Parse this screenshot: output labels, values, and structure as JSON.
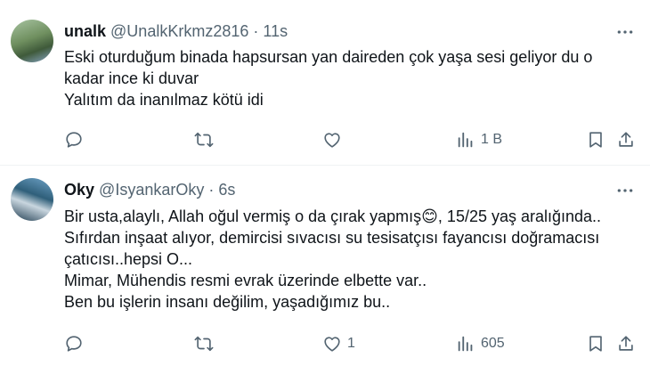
{
  "tweets": [
    {
      "name": "unalk",
      "handle": "@UnalkKrkmz2816",
      "separator": "·",
      "time": "11s",
      "lines": [
        "Eski oturduğum binada hapsursan yan daireden çok yaşa sesi geliyor du o",
        "kadar ince ki duvar",
        "Yalıtım da inanılmaz kötü idi"
      ],
      "actions": {
        "replies": "",
        "reposts": "",
        "likes": "",
        "views": "1 B"
      }
    },
    {
      "name": "Oky",
      "handle": "@IsyankarOky",
      "separator": "·",
      "time": "6s",
      "lines": [
        "Bir usta,alaylı, Allah oğul vermiş o da çırak yapmış😊, 15/25 yaş aralığında..",
        "Sıfırdan inşaat alıyor, demircisi  sıvacısı su tesisatçısı fayancısı doğramacısı",
        "çatıcısı..hepsi O...",
        "Mimar, Mühendis resmi evrak üzerinde elbette var..",
        "Ben bu işlerin insanı değilim, yaşadığımız bu.."
      ],
      "actions": {
        "replies": "",
        "reposts": "",
        "likes": "1",
        "views": "605"
      }
    }
  ],
  "icons": {
    "more": "more-icon",
    "reply": "reply-icon",
    "repost": "repost-icon",
    "like": "like-icon",
    "views": "views-icon",
    "bookmark": "bookmark-icon",
    "share": "share-icon"
  },
  "colors": {
    "text": "#0f1419",
    "muted": "#536471",
    "divider": "#eff3f4"
  }
}
